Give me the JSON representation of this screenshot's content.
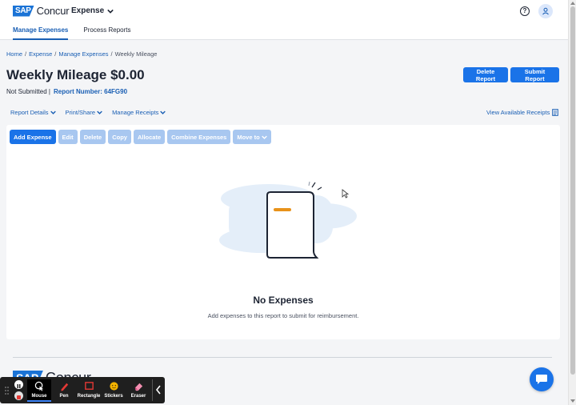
{
  "header": {
    "logo_sap": "SAP",
    "logo_text": "Concur",
    "app_menu": "Expense",
    "help": "?",
    "tabs": [
      {
        "label": "Manage Expenses"
      },
      {
        "label": "Process Reports"
      }
    ]
  },
  "breadcrumb": {
    "home": "Home",
    "expense": "Expense",
    "manage": "Manage Expenses",
    "current": "Weekly Mileage",
    "sep": "/"
  },
  "report": {
    "title": "Weekly Mileage $0.00",
    "status": "Not Submitted |",
    "number_label": "Report Number: 64FG90",
    "delete_btn": "Delete Report",
    "submit_btn": "Submit Report"
  },
  "subnav": {
    "items": [
      "Report Details",
      "Print/Share",
      "Manage Receipts"
    ],
    "view_receipts": "View Available Receipts"
  },
  "actions": [
    "Add Expense",
    "Edit",
    "Delete",
    "Copy",
    "Allocate",
    "Combine Expenses",
    "Move to"
  ],
  "empty": {
    "title": "No Expenses",
    "subtitle": "Add expenses to this report to submit for reimbursement."
  },
  "footer": {
    "logo_sap": "SAP",
    "logo_text": "Concur"
  },
  "recorder": {
    "tools": [
      "Mouse",
      "Pen",
      "Rectangle",
      "Stickers",
      "Eraser"
    ]
  },
  "colors": {
    "primary": "#1a73e8",
    "link": "#1a5fb4",
    "disabled_button": "#a8c7f0",
    "illustration_accent": "#e8921a"
  }
}
